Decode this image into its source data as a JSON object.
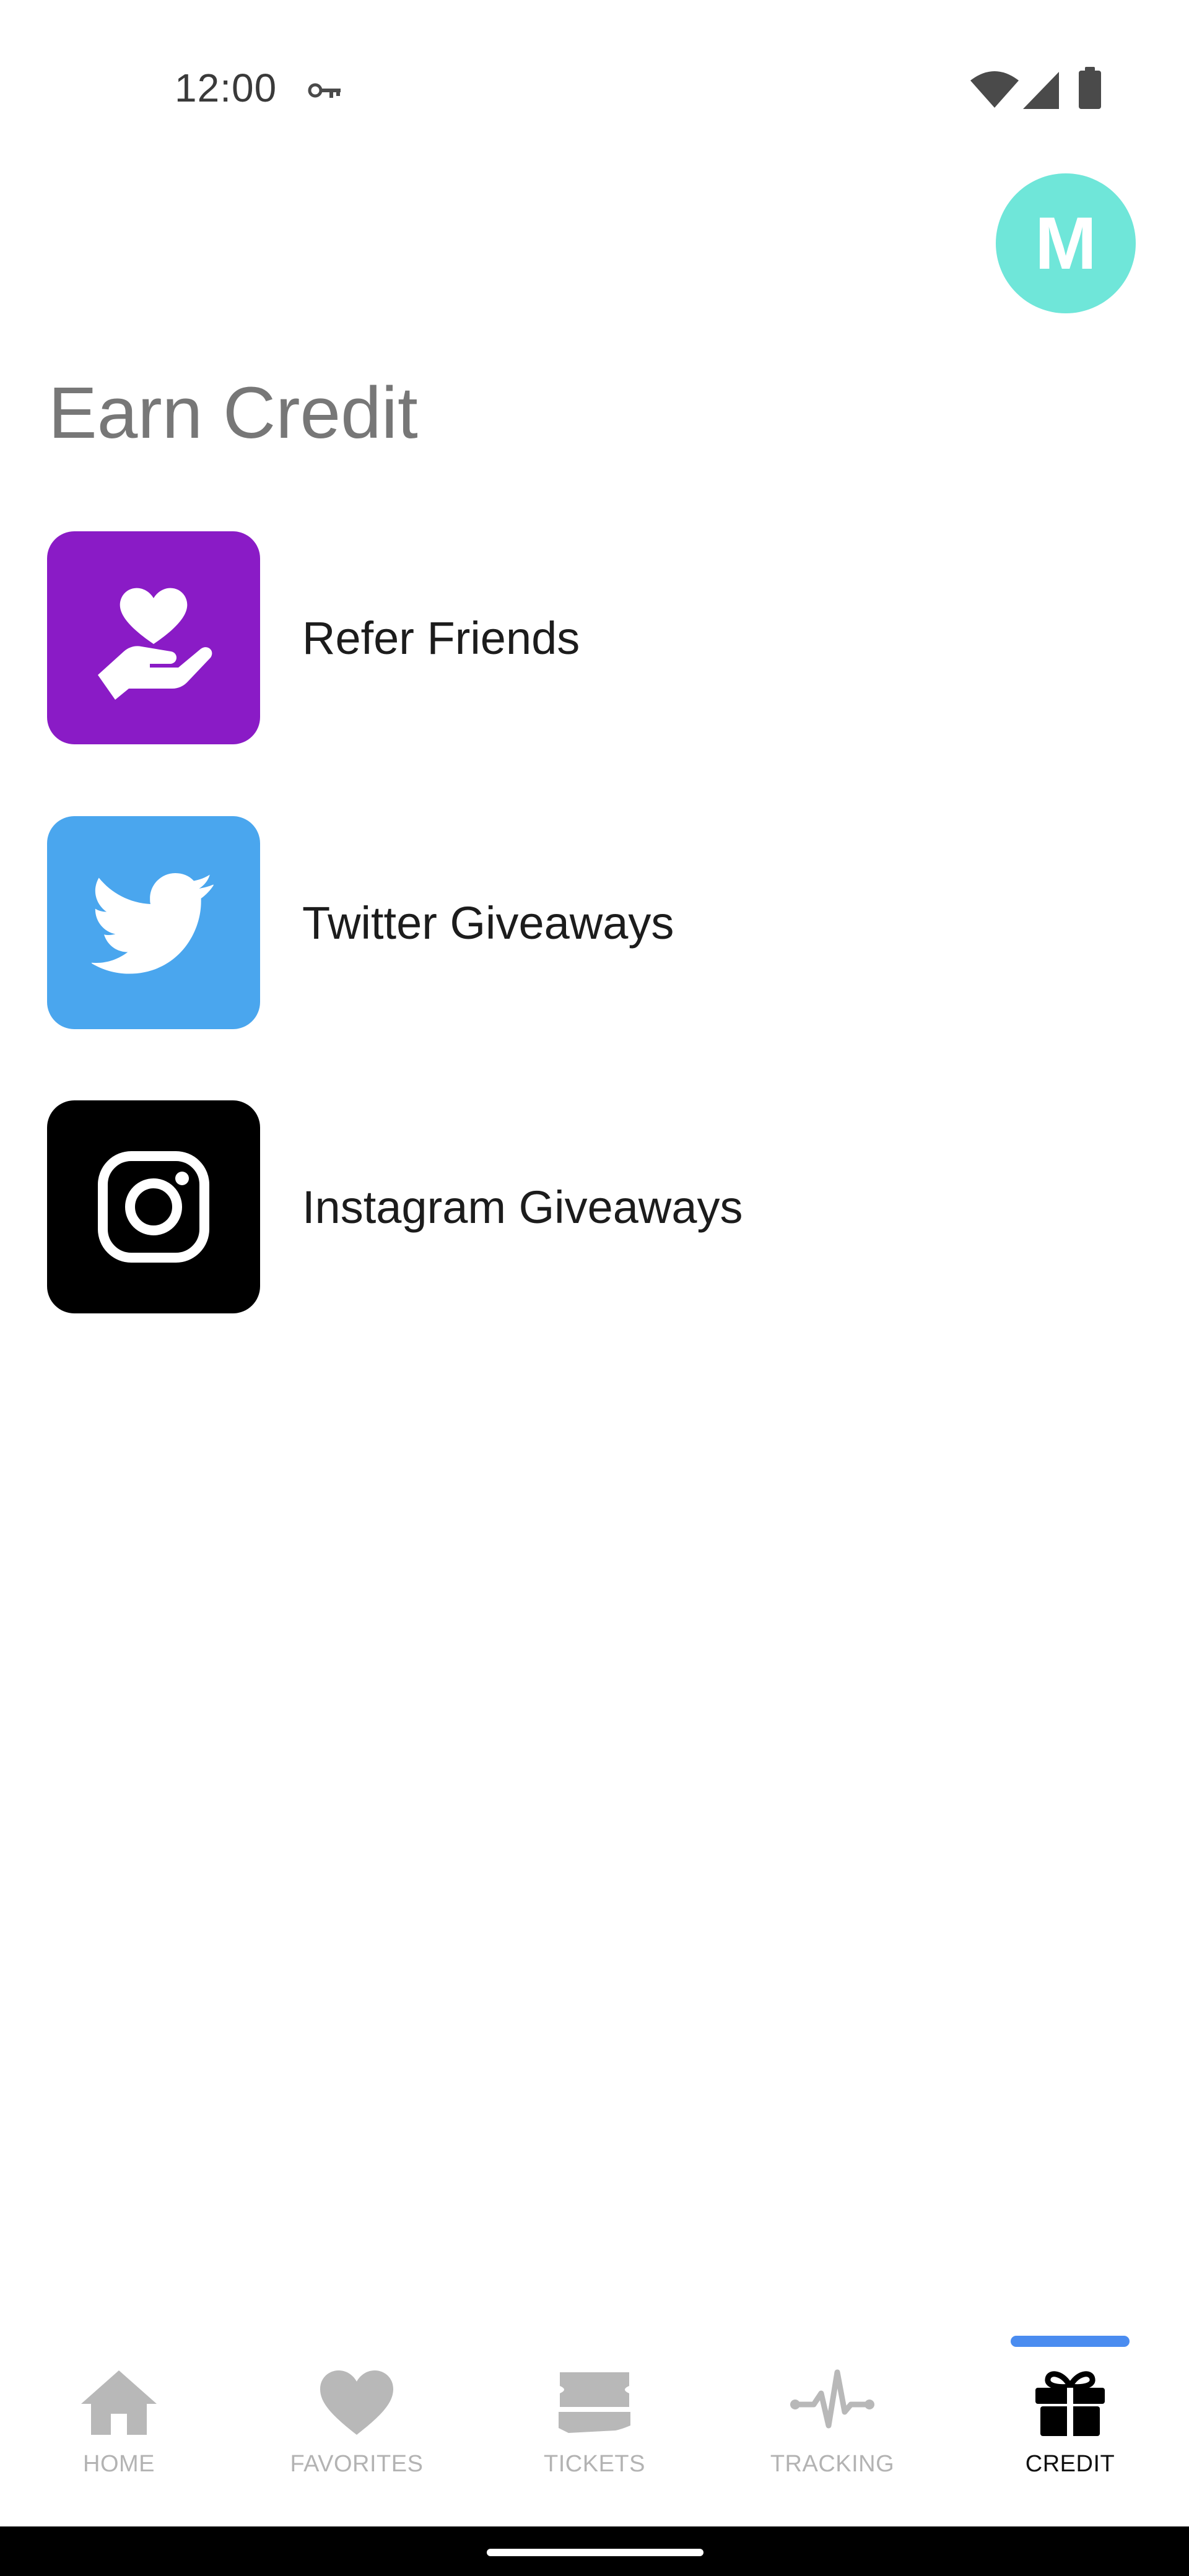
{
  "status_bar": {
    "time": "12:00",
    "icons": [
      "vpn-key-icon",
      "wifi-icon",
      "cell-signal-icon",
      "battery-icon"
    ]
  },
  "avatar": {
    "initial": "M",
    "color": "#6fe6d9"
  },
  "page": {
    "title": "Earn Credit"
  },
  "credit_options": [
    {
      "label": "Refer Friends",
      "icon": "heart-hand-icon",
      "color": "#8a1bc6"
    },
    {
      "label": "Twitter Giveaways",
      "icon": "twitter-bird-icon",
      "color": "#4aa6ee"
    },
    {
      "label": "Instagram Giveaways",
      "icon": "instagram-icon",
      "color": "#000000"
    }
  ],
  "bottom_nav": {
    "active": "CREDIT",
    "accent_color": "#4a8cf0",
    "items": [
      {
        "label": "HOME",
        "icon": "home-icon"
      },
      {
        "label": "FAVORITES",
        "icon": "heart-icon"
      },
      {
        "label": "TICKETS",
        "icon": "ticket-icon"
      },
      {
        "label": "TRACKING",
        "icon": "pulse-icon"
      },
      {
        "label": "CREDIT",
        "icon": "gift-icon"
      }
    ]
  }
}
